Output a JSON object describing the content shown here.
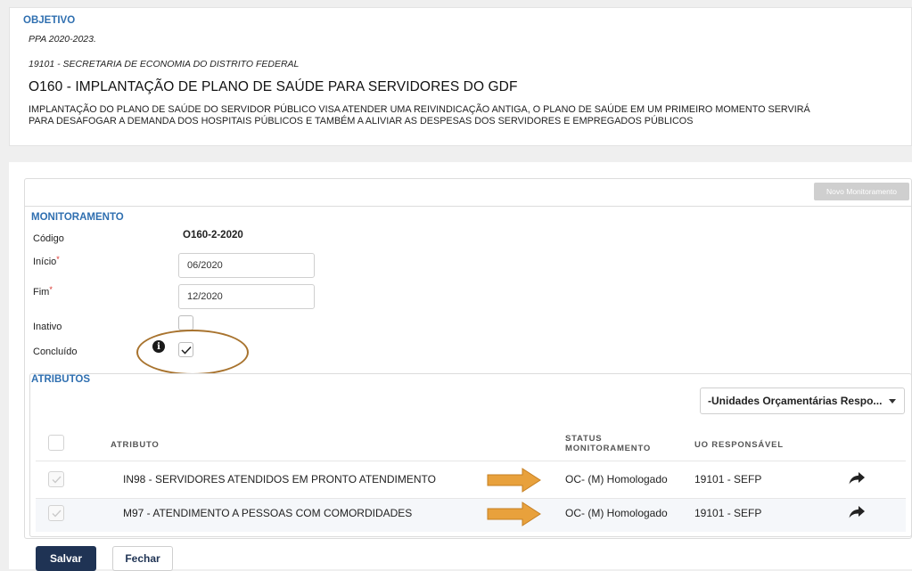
{
  "objective": {
    "section_title": "OBJETIVO",
    "ppa": "PPA 2020-2023.",
    "organ": "19101 - SECRETARIA DE ECONOMIA DO DISTRITO FEDERAL",
    "title": "O160 - IMPLANTAÇÃO DE PLANO DE SAÚDE PARA SERVIDORES DO GDF",
    "description_line1": "IMPLANTAÇÃO DO PLANO DE SAÚDE DO SERVIDOR PÚBLICO VISA ATENDER UMA REIVINDICAÇÃO ANTIGA, O PLANO DE SAÚDE EM UM PRIMEIRO MOMENTO SERVIRÁ",
    "description_line2": "PARA DESAFOGAR A DEMANDA DOS HOSPITAIS PÚBLICOS E TAMBÉM A ALIVIAR AS DESPESAS DOS SERVIDORES E EMPREGADOS PÚBLICOS"
  },
  "monitoring": {
    "new_button": "Novo Monitoramento",
    "section_title": "MONITORAMENTO",
    "code_label": "Código",
    "code_value": "O160-2-2020",
    "start_label": "Início",
    "start_value": "06/2020",
    "end_label": "Fim",
    "end_value": "12/2020",
    "required_mark": "*",
    "inactive_label": "Inativo",
    "inactive_checked": false,
    "concluded_label": "Concluído",
    "concluded_checked": true,
    "info_glyph": "i"
  },
  "attributes": {
    "section_title": "ATRIBUTOS",
    "filter_dropdown": "-Unidades Orçamentárias Respo...",
    "columns": {
      "attribute": "ATRIBUTO",
      "status_line1": "STATUS",
      "status_line2": "MONITORAMENTO",
      "uo": "UO RESPONSÁVEL"
    },
    "rows": [
      {
        "attribute": "IN98 - SERVIDORES ATENDIDOS EM PRONTO ATENDIMENTO",
        "status": "OC- (M) Homologado",
        "uo": "19101 - SEFP"
      },
      {
        "attribute": "M97 - ATENDIMENTO A PESSOAS COM COMORDIDADES",
        "status": "OC- (M) Homologado",
        "uo": "19101 - SEFP"
      }
    ]
  },
  "actions": {
    "save": "Salvar",
    "close": "Fechar"
  },
  "colors": {
    "accent": "#2f6fb0",
    "primary_button": "#1f3354",
    "annotation": "#a8732e",
    "arrow": "#e8a13c"
  }
}
